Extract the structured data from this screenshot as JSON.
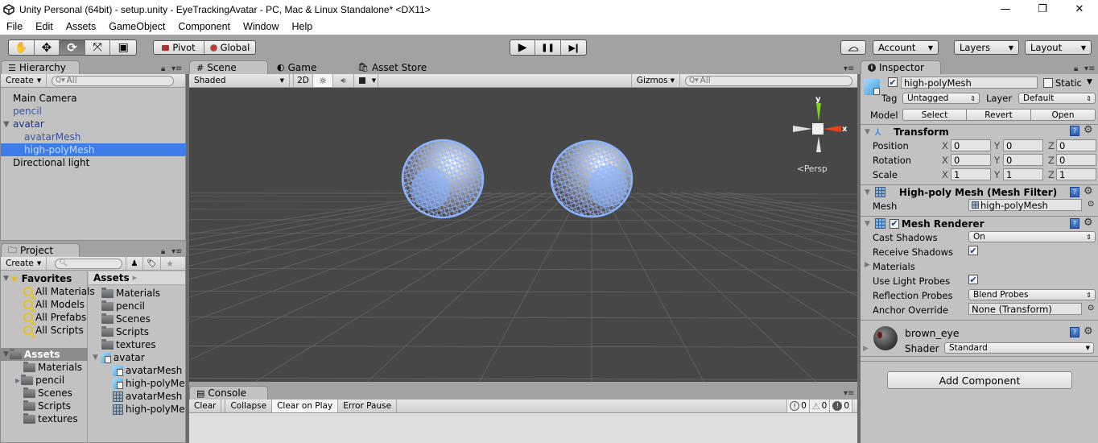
{
  "window": {
    "title": "Unity Personal (64bit) - setup.unity - EyeTrackingAvatar - PC, Mac & Linux Standalone* <DX11>",
    "minimize": "—",
    "restore": "❐",
    "close": "✕"
  },
  "menu": [
    "File",
    "Edit",
    "Assets",
    "GameObject",
    "Component",
    "Window",
    "Help"
  ],
  "toolbar": {
    "tools": [
      {
        "name": "hand-tool",
        "icon": "✋"
      },
      {
        "name": "move-tool",
        "icon": "✥"
      },
      {
        "name": "rotate-tool",
        "icon": "⟳",
        "active": true
      },
      {
        "name": "scale-tool",
        "icon": "⤧"
      },
      {
        "name": "rect-tool",
        "icon": "▣"
      }
    ],
    "pivot_label": "Pivot",
    "global_label": "Global",
    "play_icon": "▶",
    "pause_icon": "❚❚",
    "step_icon": "▶❙",
    "cloud_icon": "☁",
    "account_label": "Account",
    "layers_label": "Layers",
    "layout_label": "Layout"
  },
  "hierarchy": {
    "tab_label": "Hierarchy",
    "create_label": "Create",
    "search_placeholder": "All",
    "items": [
      {
        "label": "Main Camera",
        "type": "normal",
        "indent": 0
      },
      {
        "label": "pencil",
        "type": "prefab",
        "indent": 0
      },
      {
        "label": "avatar",
        "type": "prefab-root",
        "indent": 0,
        "expanded": true
      },
      {
        "label": "avatarMesh",
        "type": "prefab",
        "indent": 1
      },
      {
        "label": "high-polyMesh",
        "type": "prefab",
        "indent": 1,
        "selected": true
      },
      {
        "label": "Directional light",
        "type": "normal",
        "indent": 0
      }
    ]
  },
  "project": {
    "tab_label": "Project",
    "create_label": "Create",
    "favorites_label": "Favorites",
    "favorites": [
      "All Materials",
      "All Models",
      "All Prefabs",
      "All Scripts"
    ],
    "assets_label": "Assets",
    "asset_tree": [
      "Materials",
      "pencil",
      "Scenes",
      "Scripts",
      "textures"
    ],
    "breadcrumb": "Assets",
    "files": [
      {
        "label": "Materials",
        "icon": "folder",
        "indent": 0
      },
      {
        "label": "pencil",
        "icon": "folder",
        "indent": 0
      },
      {
        "label": "Scenes",
        "icon": "folder",
        "indent": 0
      },
      {
        "label": "Scripts",
        "icon": "folder",
        "indent": 0
      },
      {
        "label": "textures",
        "icon": "folder",
        "indent": 0
      },
      {
        "label": "avatar",
        "icon": "model",
        "indent": 0,
        "expanded": true
      },
      {
        "label": "avatarMesh",
        "icon": "model",
        "indent": 1
      },
      {
        "label": "high-polyMesh",
        "icon": "model",
        "indent": 1
      },
      {
        "label": "avatarMesh",
        "icon": "mesh",
        "indent": 1
      },
      {
        "label": "high-polyMesh",
        "icon": "mesh",
        "indent": 1
      }
    ]
  },
  "scene": {
    "tabs": [
      {
        "label": "Scene",
        "icon": "#",
        "active": true
      },
      {
        "label": "Game",
        "icon": "◐"
      },
      {
        "label": "Asset Store",
        "icon": "🛍"
      }
    ],
    "shading_mode": "Shaded",
    "mode_2d": "2D",
    "gizmos_label": "Gizmos",
    "search_placeholder": "All",
    "gizmo_y": "y",
    "gizmo_x": "x",
    "projection": "Persp",
    "colors": {
      "background": "#474747",
      "wireframe": "#8ab4ff",
      "gizmo_y": "#7ed321",
      "gizmo_x": "#e8401c"
    }
  },
  "console": {
    "tab_label": "Console",
    "buttons": [
      "Clear",
      "Collapse",
      "Clear on Play",
      "Error Pause"
    ],
    "info_count": "0",
    "warning_count": "0",
    "error_count": "0"
  },
  "inspector": {
    "tab_label": "Inspector",
    "object_name": "high-polyMesh",
    "active": true,
    "static_label": "Static",
    "static": false,
    "tag_label": "Tag",
    "tag_value": "Untagged",
    "layer_label": "Layer",
    "layer_value": "Default",
    "model_label": "Model",
    "model_buttons": [
      "Select",
      "Revert",
      "Open"
    ],
    "transform": {
      "title": "Transform",
      "rows": [
        {
          "label": "Position",
          "x": "0",
          "y": "0",
          "z": "0"
        },
        {
          "label": "Rotation",
          "x": "0",
          "y": "0",
          "z": "0"
        },
        {
          "label": "Scale",
          "x": "1",
          "y": "1",
          "z": "1"
        }
      ],
      "axis_labels": [
        "X",
        "Y",
        "Z"
      ]
    },
    "mesh_filter": {
      "title": "High-poly Mesh (Mesh Filter)",
      "mesh_label": "Mesh",
      "mesh_value": "high-polyMesh"
    },
    "mesh_renderer": {
      "title": "Mesh Renderer",
      "enabled": true,
      "cast_shadows_label": "Cast Shadows",
      "cast_shadows_value": "On",
      "receive_shadows_label": "Receive Shadows",
      "receive_shadows": true,
      "materials_label": "Materials",
      "light_probes_label": "Use Light Probes",
      "light_probes": true,
      "reflection_probes_label": "Reflection Probes",
      "reflection_probes_value": "Blend Probes",
      "anchor_override_label": "Anchor Override",
      "anchor_override_value": "None (Transform)"
    },
    "material": {
      "name": "brown_eye",
      "shader_label": "Shader",
      "shader_value": "Standard"
    },
    "add_component_label": "Add Component"
  }
}
